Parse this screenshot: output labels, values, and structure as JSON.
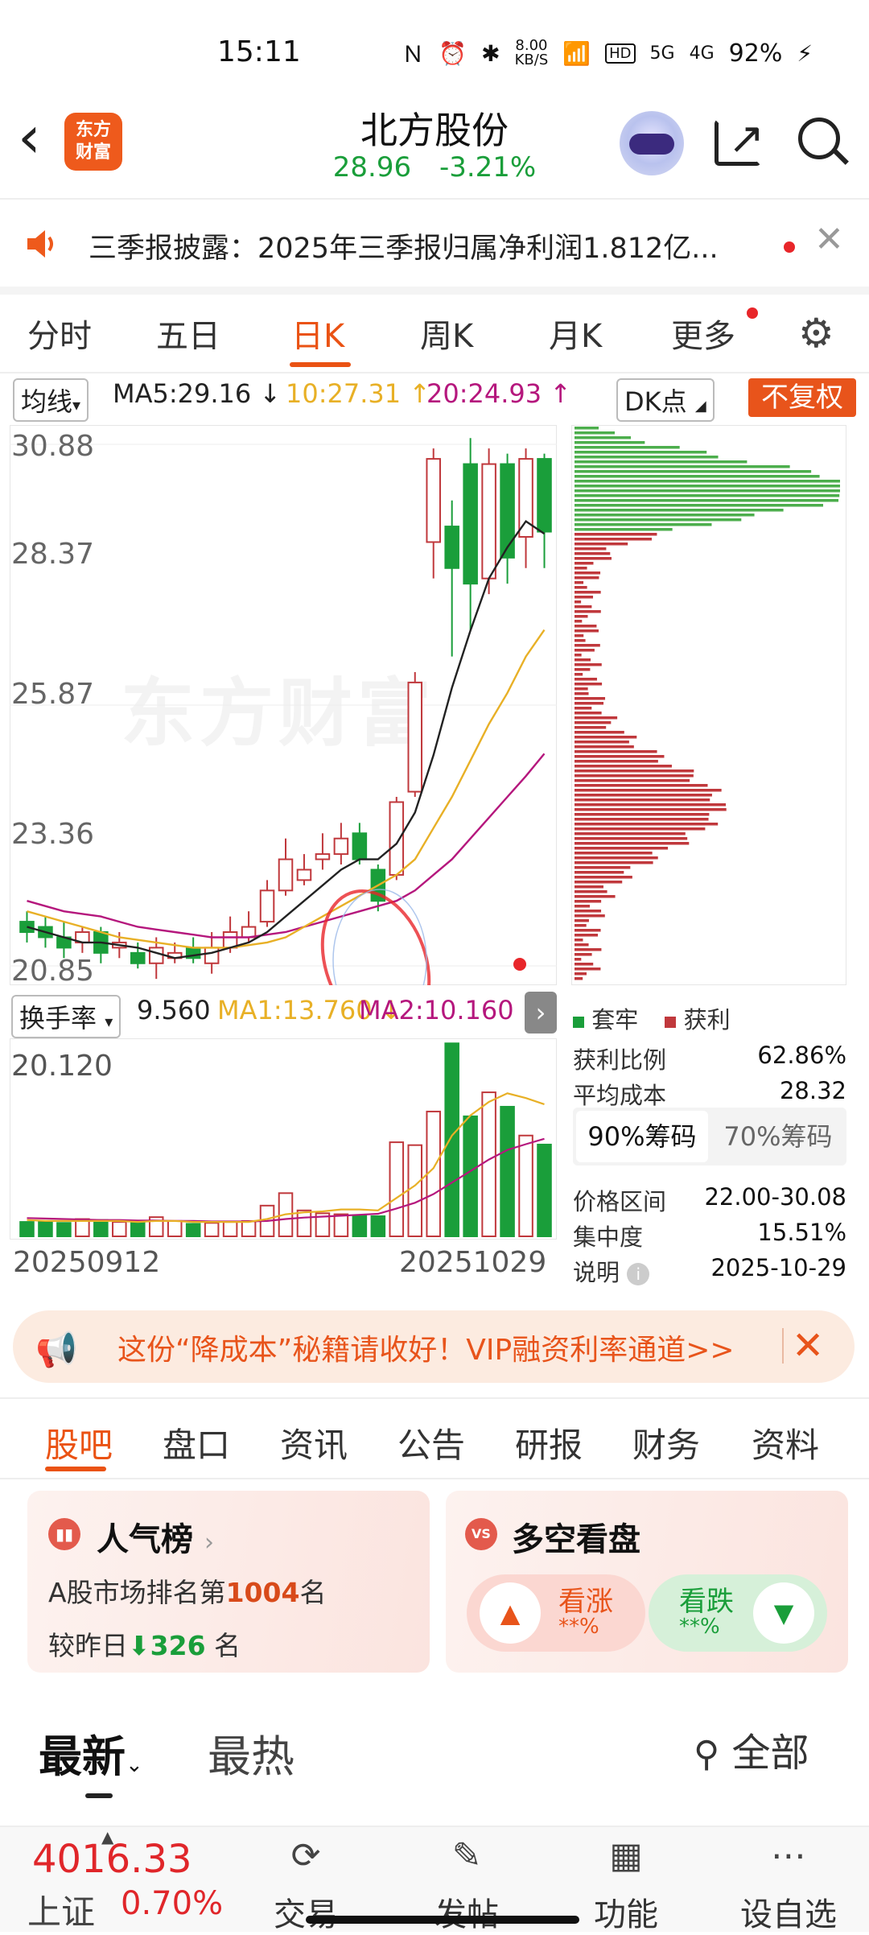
{
  "status": {
    "time": "15:11",
    "speed": "8.00\nKB/S",
    "battery": "92%",
    "net1": "5G",
    "net2": "4G",
    "hd": "HD"
  },
  "header": {
    "back": "‹",
    "logo_text": "东方\n财富",
    "stock_name": "北方股份",
    "price": "28.96",
    "change": "-3.21%"
  },
  "notice": {
    "text": "三季报披露：2025年三季报归属净利润1.812亿..."
  },
  "tabs": [
    "分时",
    "五日",
    "日K",
    "周K",
    "月K",
    "更多"
  ],
  "ma_bar": {
    "mode": "均线",
    "ma5": "MA5:29.16",
    "ma10": "10:27.31",
    "ma20": "20:24.93",
    "dk": "DK点",
    "fq": "不复权"
  },
  "y_labels": [
    "30.88",
    "28.37",
    "25.87",
    "23.36",
    "20.85"
  ],
  "watermark": "东方财富",
  "turnover_bar": {
    "label": "换手率",
    "v": "9.560",
    "ma1": "MA1:13.760",
    "ma2": "MA2:10.160"
  },
  "vol_label": "20.120",
  "dates": {
    "start": "20250912",
    "end": "20251029"
  },
  "chip_legend": {
    "hold": "套牢",
    "profit": "获利"
  },
  "chip_stats": [
    {
      "k": "获利比例",
      "v": "62.86%"
    },
    {
      "k": "平均成本",
      "v": "28.32"
    }
  ],
  "chip_tabs": {
    "a": "90%筹码",
    "b": "70%筹码"
  },
  "chip_stats2": [
    {
      "k": "价格区间",
      "v": "22.00-30.08"
    },
    {
      "k": "集中度",
      "v": "15.51%"
    },
    {
      "k": "说明",
      "v": "2025-10-29"
    }
  ],
  "promo": {
    "text": "这份“降成本”秘籍请收好！VIP融资利率通道>>"
  },
  "news_tabs": [
    "股吧",
    "盘口",
    "资讯",
    "公告",
    "研报",
    "财务",
    "资料"
  ],
  "card_rank": {
    "title": "人气榜",
    "line1_pre": "A股市场排名第",
    "rank": "1004",
    "line1_post": "名",
    "line2_pre": "较昨日",
    "down": "326",
    "line2_post": "名"
  },
  "card_vote": {
    "title": "多空看盘",
    "up_label": "看涨",
    "up_pct": "**%",
    "down_label": "看跌",
    "down_pct": "**%"
  },
  "sort": {
    "latest": "最新",
    "hot": "最热",
    "all": "全部"
  },
  "bottom": {
    "index_value": "4016.33",
    "index_name": "上证",
    "index_pct": "0.70%",
    "items": [
      "交易",
      "发帖",
      "功能",
      "设自选"
    ]
  },
  "colors": {
    "accent": "#ea5213",
    "up": "#e0262a",
    "down": "#1a9e3a"
  },
  "chart_data": {
    "type": "candlestick",
    "ylim": [
      20.85,
      30.88
    ],
    "candles": [
      {
        "o": 21.7,
        "c": 21.5,
        "h": 21.9,
        "l": 21.3
      },
      {
        "o": 21.6,
        "c": 21.4,
        "h": 21.8,
        "l": 21.2
      },
      {
        "o": 21.4,
        "c": 21.2,
        "h": 21.7,
        "l": 21.0
      },
      {
        "o": 21.3,
        "c": 21.5,
        "h": 21.6,
        "l": 21.1
      },
      {
        "o": 21.5,
        "c": 21.1,
        "h": 21.6,
        "l": 20.9
      },
      {
        "o": 21.2,
        "c": 21.3,
        "h": 21.5,
        "l": 21.0
      },
      {
        "o": 21.1,
        "c": 20.9,
        "h": 21.3,
        "l": 20.8
      },
      {
        "o": 20.9,
        "c": 21.2,
        "h": 21.4,
        "l": 20.6
      },
      {
        "o": 21.0,
        "c": 21.1,
        "h": 21.3,
        "l": 20.9
      },
      {
        "o": 21.2,
        "c": 21.0,
        "h": 21.4,
        "l": 20.9
      },
      {
        "o": 20.9,
        "c": 21.2,
        "h": 21.5,
        "l": 20.7
      },
      {
        "o": 21.2,
        "c": 21.5,
        "h": 21.8,
        "l": 21.1
      },
      {
        "o": 21.4,
        "c": 21.6,
        "h": 21.9,
        "l": 21.3
      },
      {
        "o": 21.7,
        "c": 22.3,
        "h": 22.5,
        "l": 21.6
      },
      {
        "o": 22.3,
        "c": 22.9,
        "h": 23.3,
        "l": 22.2
      },
      {
        "o": 22.5,
        "c": 22.7,
        "h": 23.0,
        "l": 22.4
      },
      {
        "o": 22.9,
        "c": 23.0,
        "h": 23.4,
        "l": 22.7
      },
      {
        "o": 23.0,
        "c": 23.3,
        "h": 23.6,
        "l": 22.8
      },
      {
        "o": 23.4,
        "c": 22.9,
        "h": 23.6,
        "l": 22.8
      },
      {
        "o": 22.7,
        "c": 22.1,
        "h": 22.8,
        "l": 21.9
      },
      {
        "o": 22.6,
        "c": 24.0,
        "h": 24.1,
        "l": 22.5
      },
      {
        "o": 24.2,
        "c": 26.3,
        "h": 26.5,
        "l": 24.1
      },
      {
        "o": 29.0,
        "c": 30.6,
        "h": 30.8,
        "l": 28.3
      },
      {
        "o": 29.3,
        "c": 28.5,
        "h": 29.8,
        "l": 26.8
      },
      {
        "o": 30.5,
        "c": 28.2,
        "h": 31.0,
        "l": 27.3
      },
      {
        "o": 28.3,
        "c": 30.5,
        "h": 30.8,
        "l": 28.0
      },
      {
        "o": 30.5,
        "c": 28.7,
        "h": 30.7,
        "l": 28.2
      },
      {
        "o": 29.1,
        "c": 30.6,
        "h": 30.8,
        "l": 28.5
      },
      {
        "o": 30.6,
        "c": 29.2,
        "h": 30.7,
        "l": 28.5
      }
    ],
    "ma5": [
      21.6,
      21.5,
      21.4,
      21.3,
      21.3,
      21.25,
      21.2,
      21.1,
      21.0,
      21.05,
      21.1,
      21.2,
      21.3,
      21.5,
      21.8,
      22.1,
      22.4,
      22.7,
      22.9,
      22.9,
      23.2,
      23.8,
      24.9,
      26.2,
      27.3,
      28.3,
      28.9,
      29.4,
      29.16
    ],
    "ma10": [
      21.9,
      21.8,
      21.7,
      21.6,
      21.5,
      21.4,
      21.35,
      21.3,
      21.25,
      21.2,
      21.2,
      21.2,
      21.25,
      21.3,
      21.4,
      21.6,
      21.8,
      22.0,
      22.2,
      22.4,
      22.6,
      22.9,
      23.5,
      24.1,
      24.8,
      25.5,
      26.1,
      26.8,
      27.31
    ],
    "ma20": [
      22.1,
      22.0,
      21.9,
      21.85,
      21.8,
      21.7,
      21.6,
      21.55,
      21.5,
      21.45,
      21.4,
      21.4,
      21.4,
      21.45,
      21.5,
      21.6,
      21.7,
      21.8,
      21.9,
      22.0,
      22.1,
      22.3,
      22.6,
      22.9,
      23.3,
      23.7,
      24.1,
      24.5,
      24.93
    ],
    "turnover": [
      1.5,
      1.6,
      1.4,
      1.8,
      1.7,
      1.5,
      1.4,
      2.0,
      1.6,
      1.3,
      1.4,
      1.5,
      1.6,
      3.2,
      4.5,
      2.7,
      2.4,
      2.3,
      2.2,
      2.1,
      9.8,
      9.5,
      13.0,
      20.1,
      12.5,
      15.0,
      13.5,
      10.5,
      9.56
    ],
    "turnover_ma1": [
      1.7,
      1.6,
      1.6,
      1.6,
      1.6,
      1.6,
      1.5,
      1.6,
      1.6,
      1.5,
      1.5,
      1.5,
      1.5,
      1.8,
      2.3,
      2.5,
      2.6,
      2.8,
      2.8,
      2.7,
      4.0,
      5.3,
      7.1,
      10.5,
      12.6,
      14.0,
      14.9,
      14.4,
      13.76
    ],
    "turnover_ma2": [
      1.9,
      1.85,
      1.8,
      1.75,
      1.7,
      1.7,
      1.65,
      1.65,
      1.6,
      1.6,
      1.55,
      1.55,
      1.55,
      1.6,
      1.8,
      1.95,
      2.05,
      2.15,
      2.25,
      2.35,
      2.9,
      3.5,
      4.4,
      5.6,
      6.8,
      8.0,
      9.0,
      9.6,
      10.16
    ],
    "vol_ylim": [
      0,
      20.12
    ]
  }
}
